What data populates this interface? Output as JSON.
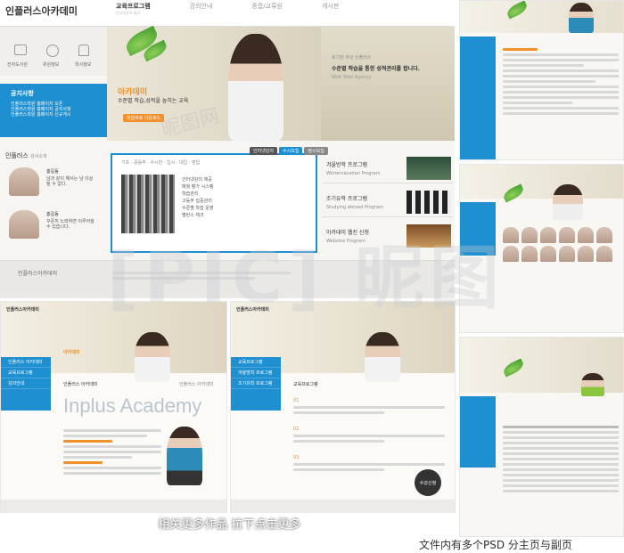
{
  "main_page": {
    "logo": "인플러스아카데미",
    "nav": [
      "교육프로그램",
      "강의안내",
      "종합/교류원",
      "게시판"
    ],
    "quick_icons": [
      "전자도서관",
      "위원정보",
      "학사정보"
    ],
    "hero_label": "아카데미",
    "hero_title": "수준별 학습,성적을 높히는 교육",
    "hero_button": "학습자료 다운로드",
    "right_hero_small": "쉬기만 하던 인플러스",
    "right_hero_title": "수준별 학습을 통한 성적관리를 합니다.",
    "right_hero_sub": "Web Total Agency",
    "notice_title": "공지사항",
    "notice_items": [
      "인플러스학원 홈페이지 오픈",
      "인플러스학원 홈페이지 공지사항",
      "인플러스학원 홈페이지 신규게시"
    ],
    "teacher_section": "인플러스",
    "teacher_sub": "강사소개",
    "teachers": [
      {
        "name": "홍길동",
        "desc": "남과 같이 해서는 남 이상 될 수 없다."
      },
      {
        "name": "홍길동",
        "desc": "꾸준히 노력하면 이루어질 수 있습니다."
      }
    ],
    "tabs": [
      "인터넷강의",
      "수시모집",
      "정시모집"
    ],
    "tab_menu": "기초 · 중등부 · 수시반 · 입시 · 대입 · 편입",
    "course_list": [
      "인터넷강의 제공",
      "매월 평가 시스템",
      "학습관리",
      "고등부 집중관리",
      "수준별 학습 운영",
      "밸런스 체크"
    ],
    "programs": [
      {
        "title": "겨울방학 프로그램",
        "sub": "Wintervacation Program"
      },
      {
        "title": "조기유학 프로그램",
        "sub": "Studying abroad Program"
      },
      {
        "title": "아카데미 웹진 신청",
        "sub": "Webzine Program"
      }
    ],
    "footer_logo": "인플러스아카데미"
  },
  "sub_pages": {
    "inplus_title": "Inplus Academy",
    "breadcrumb_a": "인플러스 아카데미",
    "breadcrumb_b": "교육프로그램",
    "side_label": "인플러스 아카데미",
    "page_heading": "인플러스 아카데미",
    "steps": [
      "01",
      "02",
      "03"
    ],
    "badge": "수강신청"
  },
  "bottom_banner": "相关更多作品  拉下点击更多",
  "bottom_caption": "文件内有多个PSD 分主页与副页",
  "watermark": "[PIC] 昵图",
  "colors": {
    "blue": "#1e8fd0",
    "orange": "#f0912b",
    "green": "#5fa52f"
  }
}
